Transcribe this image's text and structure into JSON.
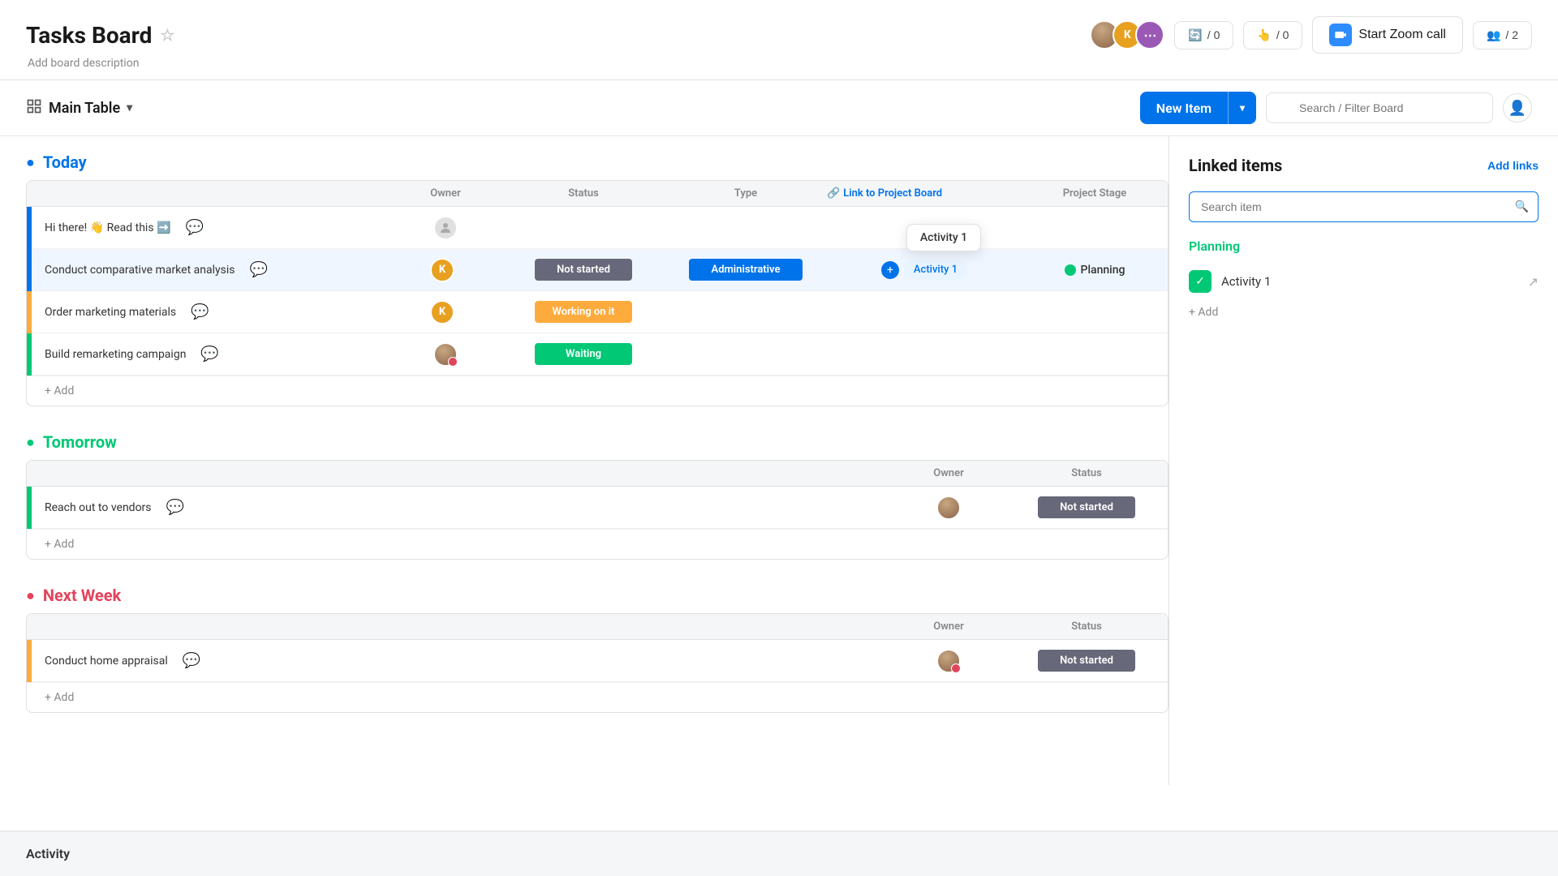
{
  "header": {
    "title": "Tasks Board",
    "subtitle": "Add board description",
    "star_label": "★",
    "zoom_button": "Start Zoom call",
    "activity_count": "/ 0",
    "update_count": "/ 0",
    "people_count": "/ 2"
  },
  "toolbar": {
    "main_table_label": "Main Table",
    "new_item_label": "New Item",
    "search_placeholder": "Search / Filter Board"
  },
  "sections": [
    {
      "id": "today",
      "title": "Today",
      "color_class": "today",
      "rows": [
        {
          "id": 1,
          "name": "Hi there! 👋 Read this ➡️",
          "owner": null,
          "status": "",
          "type": "",
          "link": "",
          "stage": "",
          "indicator": "blue"
        },
        {
          "id": 2,
          "name": "Conduct comparative market analysis",
          "owner": "K",
          "status": "Not started",
          "status_class": "not-started",
          "type": "Administrative",
          "link": "Activity 1",
          "stage": "Planning",
          "indicator": "blue"
        },
        {
          "id": 3,
          "name": "Order marketing materials",
          "owner": "K",
          "status": "Working on it",
          "status_class": "working",
          "type": "",
          "link": "",
          "stage": "",
          "indicator": "orange"
        },
        {
          "id": 4,
          "name": "Build remarketing campaign",
          "owner": "avatar",
          "status": "Waiting",
          "status_class": "waiting",
          "type": "",
          "link": "",
          "stage": "",
          "indicator": "green"
        }
      ],
      "add_label": "+ Add"
    },
    {
      "id": "tomorrow",
      "title": "Tomorrow",
      "color_class": "tomorrow",
      "rows": [
        {
          "id": 5,
          "name": "Reach out to vendors",
          "owner": "avatar2",
          "status": "Not started",
          "status_class": "not-started",
          "type": "",
          "link": "",
          "stage": "",
          "indicator": "green"
        }
      ],
      "add_label": "+ Add"
    },
    {
      "id": "nextweek",
      "title": "Next Week",
      "color_class": "nextweek",
      "rows": [
        {
          "id": 6,
          "name": "Conduct home appraisal",
          "owner": "avatar",
          "status": "Not started",
          "status_class": "not-started",
          "type": "",
          "link": "",
          "stage": "",
          "indicator": "orange"
        }
      ],
      "add_label": "+ Add"
    }
  ],
  "columns": {
    "owner": "Owner",
    "status": "Status",
    "type": "Type",
    "link": "Link to Project Board",
    "stage": "Project Stage"
  },
  "linked_panel": {
    "title": "Linked items",
    "add_links": "Add links",
    "search_placeholder": "Search item",
    "planning_title": "Planning",
    "linked_item_name": "Activity 1",
    "add_label": "+ Add"
  },
  "tooltip": {
    "text": "Activity 1"
  },
  "activity_bar": {
    "label": "Activity"
  }
}
